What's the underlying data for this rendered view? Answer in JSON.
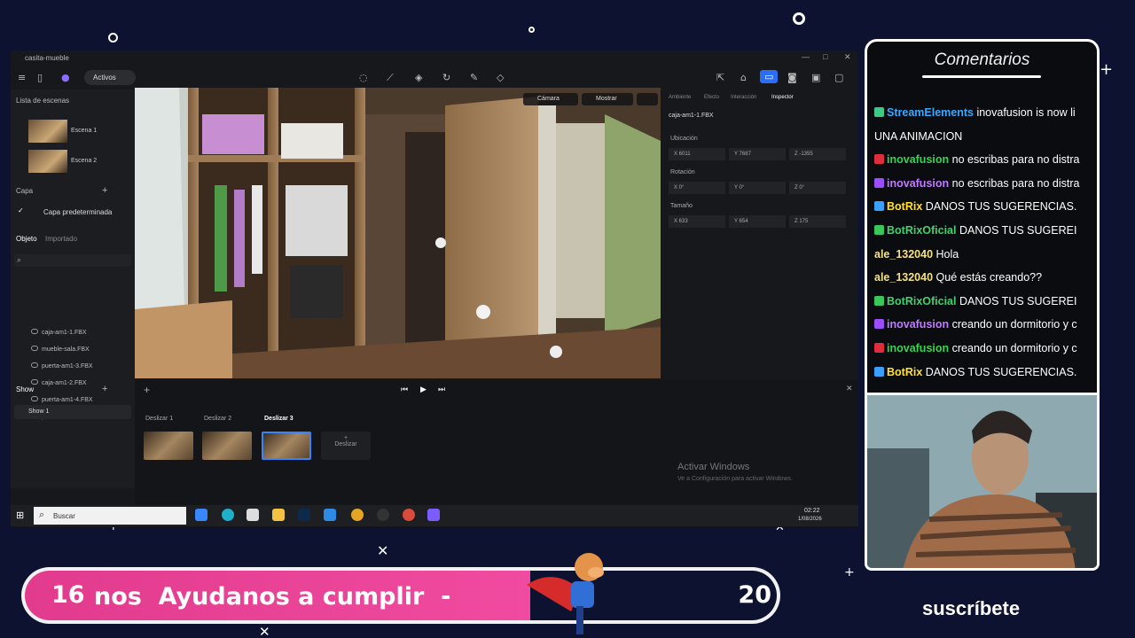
{
  "app": {
    "title": "casita-mueble",
    "toolbar": {
      "assets_label": "Activos"
    },
    "sidebar": {
      "scenes_header": "Lista de escenas",
      "scenes": [
        {
          "label": "Escena 1"
        },
        {
          "label": "Escena 2"
        }
      ],
      "layer_header": "Capa",
      "default_layer": "Capa predeterminada",
      "object_tab": "Objeto",
      "imported_tab": "Importado",
      "objects": [
        "caja-am1-1.FBX",
        "mueble-sala.FBX",
        "puerta-am1-3.FBX",
        "caja-am1-2.FBX",
        "puerta-am1-4.FBX",
        "puerta-am1-3.FBX"
      ],
      "show_header": "Show",
      "show_item": "Show 1"
    },
    "viewport": {
      "camera_label": "Cámara",
      "show_label": "Mostrar"
    },
    "inspector": {
      "tabs": [
        "Ambiente",
        "Efecto",
        "Interacción",
        "Inspector"
      ],
      "active_tab": "Inspector",
      "object_name": "caja-am1-1.FBX",
      "location_label": "Ubicación",
      "location": {
        "x": "X  6011",
        "y": "Y  7687",
        "z": "Z  -1355"
      },
      "rotation_label": "Rotación",
      "rotation": {
        "x": "X  0°",
        "y": "Y  0°",
        "z": "Z  0°"
      },
      "size_label": "Tamaño",
      "size": {
        "x": "X  633",
        "y": "Y  654",
        "z": "Z  175"
      }
    },
    "timeline": {
      "slides": [
        "Deslizar 1",
        "Deslizar 2",
        "Deslizar 3"
      ],
      "add_slide": "Deslizar",
      "activate_title": "Activar Windows",
      "activate_sub": "Ve a Configuración para activar Windows."
    }
  },
  "taskbar": {
    "search_placeholder": "Buscar",
    "time": "02:22",
    "date": "1/08/2026"
  },
  "chat": {
    "title": "Comentarios",
    "messages": [
      {
        "user": "StreamElements",
        "text": "inovafusion is now li",
        "color": "#39a9ff",
        "badge": "#3cc98a"
      },
      {
        "user": "",
        "text": "UNA ANIMACION",
        "color": "#ffffff",
        "badge": ""
      },
      {
        "user": "inovafusion",
        "text": "no escribas para no distra",
        "color": "#39d353",
        "badge": "#e02d3c"
      },
      {
        "user": "inovafusion",
        "text": "no escribas para no distra",
        "color": "#c07bff",
        "badge": "#9b4dff"
      },
      {
        "user": "BotRix",
        "text": "DANOS TUS SUGERENCIAS.",
        "color": "#ffe033",
        "badge": "#3aa0ff"
      },
      {
        "user": "BotRixOficial",
        "text": "DANOS TUS SUGEREI",
        "color": "#3fd36b",
        "badge": "#38c85a"
      },
      {
        "user": "ale_132040",
        "text": "Hola",
        "color": "#f3e18a",
        "badge": ""
      },
      {
        "user": "ale_132040",
        "text": "Qué estás creando??",
        "color": "#f3e18a",
        "badge": ""
      },
      {
        "user": "BotRixOficial",
        "text": "DANOS TUS SUGEREI",
        "color": "#3fd36b",
        "badge": "#38c85a"
      },
      {
        "user": "inovafusion",
        "text": "creando un dormitorio y c",
        "color": "#c07bff",
        "badge": "#9b4dff"
      },
      {
        "user": "inovafusion",
        "text": "creando un dormitorio y c",
        "color": "#39d353",
        "badge": "#e02d3c"
      },
      {
        "user": "BotRix",
        "text": "DANOS TUS SUGERENCIAS.",
        "color": "#ffe033",
        "badge": "#3aa0ff"
      }
    ]
  },
  "goal": {
    "current": "16",
    "text": "nos  Ayudanos a cumplir  -",
    "target": "20",
    "progress": 0.8
  },
  "subscribe": "suscríbete"
}
